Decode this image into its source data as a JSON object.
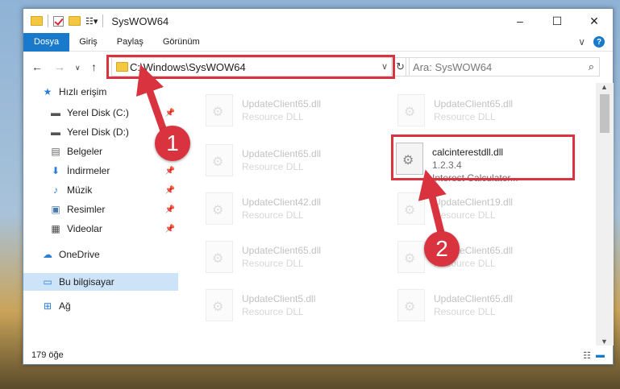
{
  "window": {
    "title": "SysWOW64",
    "minimize": "–",
    "maximize": "☐",
    "close": "✕"
  },
  "ribbon": {
    "tabs": [
      "Dosya",
      "Giriş",
      "Paylaş",
      "Görünüm"
    ],
    "collapse": "∨",
    "help": "?"
  },
  "nav": {
    "back": "←",
    "forward": "→",
    "recent": "∨",
    "up": "↑",
    "address": "C:\\Windows\\SysWOW64",
    "address_dropdown": "∨",
    "refresh": "↻",
    "search_placeholder": "Ara: SysWOW64",
    "search_icon": "⌕"
  },
  "sidebar": {
    "items": [
      {
        "label": "Hızlı erişim",
        "icon": "star-icon",
        "glyph": "★",
        "color": "#2a7fd4"
      },
      {
        "label": "Yerel Disk (C:)",
        "icon": "drive-icon",
        "glyph": "▬",
        "color": "#555",
        "pinned": true
      },
      {
        "label": "Yerel Disk (D:)",
        "icon": "drive-icon",
        "glyph": "▬",
        "color": "#555",
        "pinned": true
      },
      {
        "label": "Belgeler",
        "icon": "documents-icon",
        "glyph": "▤",
        "color": "#666",
        "pinned": true
      },
      {
        "label": "İndirmeler",
        "icon": "download-icon",
        "glyph": "⬇",
        "color": "#2a7fd4",
        "pinned": true
      },
      {
        "label": "Müzik",
        "icon": "music-icon",
        "glyph": "♪",
        "color": "#2a7fd4",
        "pinned": true
      },
      {
        "label": "Resimler",
        "icon": "pictures-icon",
        "glyph": "▣",
        "color": "#4a7aa8",
        "pinned": true
      },
      {
        "label": "Videolar",
        "icon": "video-icon",
        "glyph": "▦",
        "color": "#444",
        "pinned": true
      },
      {
        "label": "OneDrive",
        "icon": "cloud-icon",
        "glyph": "☁",
        "color": "#2a7fd4"
      },
      {
        "label": "Bu bilgisayar",
        "icon": "computer-icon",
        "glyph": "▭",
        "color": "#2a7fd4",
        "selected": true
      },
      {
        "label": "Ağ",
        "icon": "network-icon",
        "glyph": "⊞",
        "color": "#2a7fd4"
      }
    ],
    "pin_glyph": "📌"
  },
  "files": [
    {
      "name": "UpdateClient65.dll",
      "type": "Resource DLL",
      "dim": true
    },
    {
      "name": "UpdateClient65.dll",
      "type": "Resource DLL",
      "dim": true
    },
    {
      "name": "UpdateClient65.dll",
      "type": "Resource DLL",
      "dim": true
    },
    {
      "name": "calcinterestdll.dll",
      "version": "1.2.3.4",
      "type": "Interest Calculator...",
      "dim": false
    },
    {
      "name": "UpdateClient42.dll",
      "type": "Resource DLL",
      "dim": true
    },
    {
      "name": "UpdateClient19.dll",
      "type": "Resource DLL",
      "dim": true
    },
    {
      "name": "UpdateClient65.dll",
      "type": "Resource DLL",
      "dim": true
    },
    {
      "name": "UpdateClient65.dll",
      "type": "Resource DLL",
      "dim": true
    },
    {
      "name": "UpdateClient5.dll",
      "type": "Resource DLL",
      "dim": true
    },
    {
      "name": "UpdateClient65.dll",
      "type": "Resource DLL",
      "dim": true
    }
  ],
  "status": {
    "count": "179 öğe",
    "view_details": "☷",
    "view_tiles": "▬"
  },
  "scroll": {
    "up": "▲",
    "down": "▼"
  },
  "annotations": {
    "badge1": "1",
    "badge2": "2",
    "accent": "#d9333f"
  }
}
